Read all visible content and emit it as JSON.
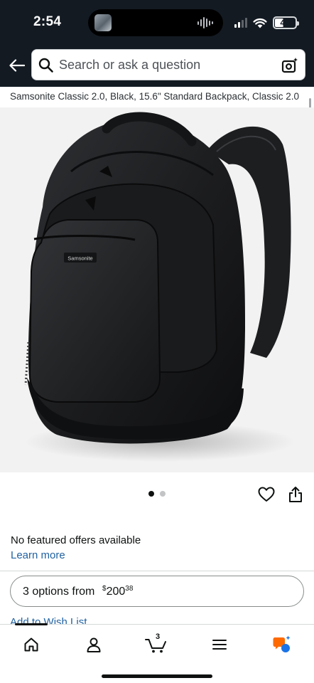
{
  "status_bar": {
    "time": "2:54",
    "battery": "40"
  },
  "search": {
    "placeholder": "Search or ask a question"
  },
  "product": {
    "title": "Samsonite Classic 2.0, Black, 15.6\" Standard Backpack, Classic 2.0",
    "image_brand_label": "Samsonite"
  },
  "carousel": {
    "current_index": 1,
    "total": 2
  },
  "offers": {
    "message": "No featured offers available",
    "learn_more": "Learn more"
  },
  "options_button": {
    "label": "3 options from",
    "currency": "$",
    "price_whole": "200",
    "price_fraction": "38"
  },
  "wishlist": {
    "label": "Add to Wish List"
  },
  "bottom_nav": {
    "cart_count": "3",
    "items": [
      "home",
      "account",
      "cart",
      "menu",
      "rufus"
    ]
  },
  "colors": {
    "header_bg": "#131a22",
    "link": "#2162a1",
    "rufus_orange": "#ff6a00",
    "rufus_blue": "#1a73e8"
  }
}
